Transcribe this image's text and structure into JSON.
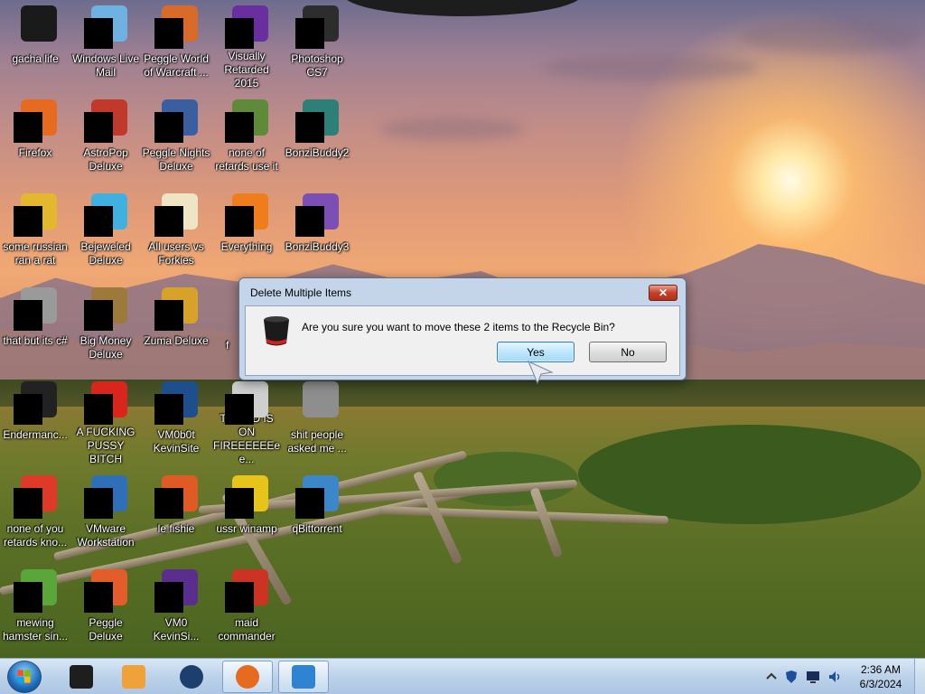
{
  "desktop": {
    "icons": [
      {
        "label": "gacha life",
        "icon": "recycle-bin-icon",
        "color": "#1a1a1a",
        "redacted": false
      },
      {
        "label": "Windows Live Mail",
        "icon": "mail-icon",
        "color": "#6fb1e0",
        "redacted": true
      },
      {
        "label": "Peggle World of Warcraft ...",
        "icon": "peggle-icon",
        "color": "#d86a2a",
        "redacted": true
      },
      {
        "label": "Visually Retarded 2015",
        "icon": "visual-studio-icon",
        "color": "#6a2f9e",
        "redacted": true
      },
      {
        "label": "Photoshop CS7",
        "icon": "photoshop-icon",
        "color": "#2d2d2d",
        "redacted": true
      },
      {
        "label": "Firefox",
        "icon": "firefox-icon",
        "color": "#e66a1f",
        "redacted": true
      },
      {
        "label": "AstroPop Deluxe",
        "icon": "astropop-icon",
        "color": "#c0392b",
        "redacted": true
      },
      {
        "label": "Peggle Nights Deluxe",
        "icon": "peggle-nights-icon",
        "color": "#3a5fa0",
        "redacted": true
      },
      {
        "label": "none of retards use it",
        "icon": "plant-icon",
        "color": "#5f8a3a",
        "redacted": true
      },
      {
        "label": "BonziBuddy2",
        "icon": "bonzi-icon",
        "color": "#2d7f77",
        "redacted": true
      },
      {
        "label": "some russian ran a rat",
        "icon": "app-icon",
        "color": "#e4b82e",
        "redacted": true
      },
      {
        "label": "Bejeweled Deluxe",
        "icon": "gem-icon",
        "color": "#3fb0e0",
        "redacted": true
      },
      {
        "label": "All users vs Forkies",
        "icon": "flower-icon",
        "color": "#efe4c4",
        "redacted": true
      },
      {
        "label": "Everything",
        "icon": "search-ring-icon",
        "color": "#f07d1c",
        "redacted": true
      },
      {
        "label": "BonziBuddy3",
        "icon": "bonzi-purple-icon",
        "color": "#7b4fb3",
        "redacted": true
      },
      {
        "label": "that but its c#",
        "icon": "windows-stack-icon",
        "color": "#9a9a9a",
        "redacted": true
      },
      {
        "label": "Big Money Deluxe",
        "icon": "money-icon",
        "color": "#9c7a3c",
        "redacted": true
      },
      {
        "label": "Zuma Deluxe",
        "icon": "zuma-icon",
        "color": "#d6a22a",
        "redacted": true
      },
      {
        "label": "Endermanc...",
        "icon": "terminal-icon",
        "color": "#222222",
        "redacted": true
      },
      {
        "label": "A FUCKING PUSSY BITCH",
        "icon": "red-ball-icon",
        "color": "#d9261c",
        "redacted": true
      },
      {
        "label": "VM0b0t KevinSite",
        "icon": "vm-icon",
        "color": "#1f4e8c",
        "redacted": true
      },
      {
        "label": "THE CD IS ON FIREEEEEEee...",
        "icon": "cd-icon",
        "color": "#cfcfcf",
        "redacted": true
      },
      {
        "label": "shit people asked me ...",
        "icon": "folder-icon",
        "color": "#8e8e8e",
        "redacted": false
      },
      {
        "label": "none of you retards kno...",
        "icon": "chrome-icon",
        "color": "#dd3a2a",
        "redacted": true
      },
      {
        "label": "VMware Workstation",
        "icon": "vmware-icon",
        "color": "#2e6fb8",
        "redacted": true
      },
      {
        "label": "le fishie",
        "icon": "fish-icon",
        "color": "#e05a25",
        "redacted": true
      },
      {
        "label": "ussr winamp",
        "icon": "winamp-icon",
        "color": "#e6c419",
        "redacted": true
      },
      {
        "label": "qBittorrent",
        "icon": "qbittorrent-icon",
        "color": "#3c87c9",
        "redacted": true
      },
      {
        "label": "mewing hamster sin...",
        "icon": "hamster-icon",
        "color": "#5aa63a",
        "redacted": true
      },
      {
        "label": "Peggle Deluxe",
        "icon": "peggle-deluxe-icon",
        "color": "#e35d2a",
        "redacted": true
      },
      {
        "label": "VM0 KevinSi...",
        "icon": "vm0-icon",
        "color": "#5a2e8c",
        "redacted": true
      },
      {
        "label": "maid commander",
        "icon": "maid-icon",
        "color": "#cc3322",
        "redacted": true
      }
    ],
    "partial_label": "f"
  },
  "dialog": {
    "title": "Delete Multiple Items",
    "close_label": "✕",
    "message": "Are you sure you want to move these 2 items to the Recycle Bin?",
    "yes_label": "Yes",
    "no_label": "No",
    "icon": "recycle-bin-icon"
  },
  "taskbar": {
    "start": "start-orb-icon",
    "items": [
      {
        "name": "taskbar-item-dark-app",
        "icon": "dark-box-icon",
        "color": "#1e1e1e",
        "active": false
      },
      {
        "name": "taskbar-item-media-player",
        "icon": "media-player-icon",
        "color": "#f0a23a",
        "active": false
      },
      {
        "name": "taskbar-item-blue-orb",
        "icon": "blue-orb-icon",
        "color": "#1d3f6e",
        "active": false
      },
      {
        "name": "taskbar-item-firefox",
        "icon": "firefox-icon",
        "color": "#e66a1f",
        "active": true
      },
      {
        "name": "taskbar-item-explorer",
        "icon": "explorer-icon",
        "color": "#2e84d0",
        "active": true
      }
    ],
    "tray": [
      "chevron-up-icon",
      "shield-icon",
      "monitor-icon",
      "speaker-icon"
    ],
    "time": "2:36 AM",
    "date": "6/3/2024"
  }
}
